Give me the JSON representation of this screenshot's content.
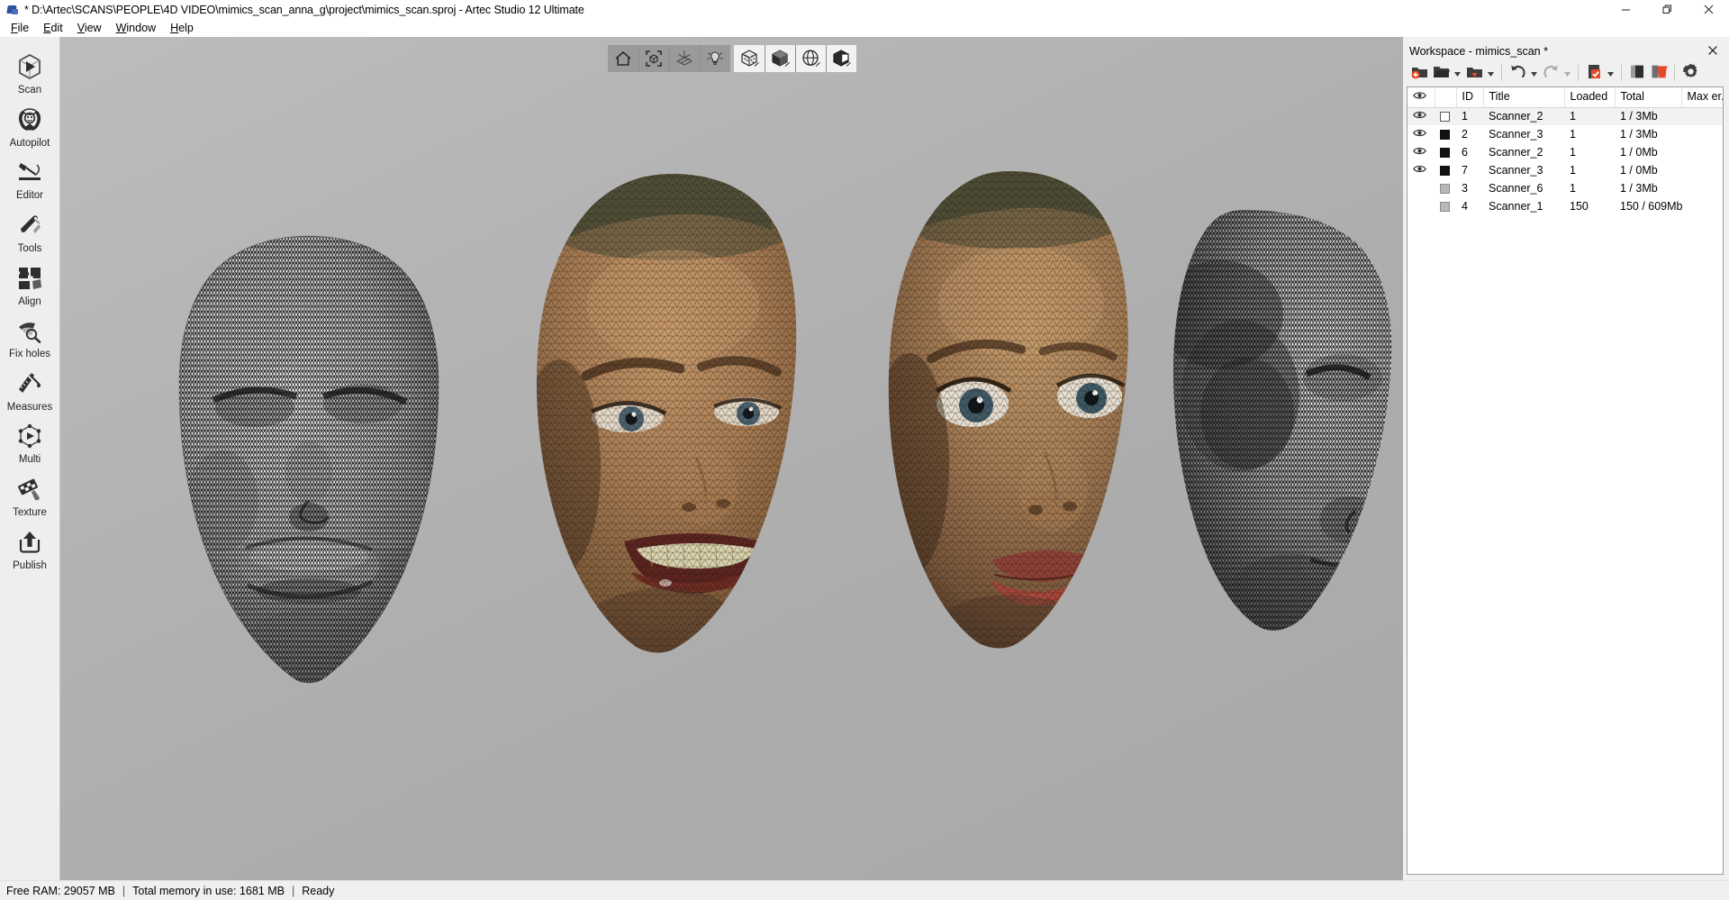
{
  "window": {
    "title": "* D:\\Artec\\SCANS\\PEOPLE\\4D VIDEO\\mimics_scan_anna_g\\project\\mimics_scan.sproj - Artec Studio 12 Ultimate",
    "app_icon": "artec-app-icon",
    "controls": {
      "minimize": "minimize-button",
      "restore": "restore-button",
      "close": "close-button"
    }
  },
  "menubar": {
    "items": [
      {
        "label": "File",
        "accel": "F"
      },
      {
        "label": "Edit",
        "accel": "E"
      },
      {
        "label": "View",
        "accel": "V"
      },
      {
        "label": "Window",
        "accel": "W"
      },
      {
        "label": "Help",
        "accel": "H"
      }
    ]
  },
  "sidebar": {
    "items": [
      {
        "label": "Scan",
        "icon": "scan-icon"
      },
      {
        "label": "Autopilot",
        "icon": "autopilot-icon"
      },
      {
        "label": "Editor",
        "icon": "editor-icon"
      },
      {
        "label": "Tools",
        "icon": "tools-icon"
      },
      {
        "label": "Align",
        "icon": "align-icon"
      },
      {
        "label": "Fix holes",
        "icon": "fix-holes-icon"
      },
      {
        "label": "Measures",
        "icon": "measures-icon"
      },
      {
        "label": "Multi",
        "icon": "multi-icon"
      },
      {
        "label": "Texture",
        "icon": "texture-icon"
      },
      {
        "label": "Publish",
        "icon": "publish-icon"
      }
    ]
  },
  "viewport": {
    "toolbar": {
      "group1": [
        {
          "name": "home-view-button",
          "icon": "home-icon"
        },
        {
          "name": "fit-to-view-button",
          "icon": "bounding-box-icon"
        },
        {
          "name": "toggle-grid-button",
          "icon": "grid-axes-icon"
        },
        {
          "name": "lighting-button",
          "icon": "lightbulb-icon"
        }
      ],
      "group2": [
        {
          "name": "render-points-button",
          "icon": "cube-points-icon"
        },
        {
          "name": "render-solid-button",
          "icon": "cube-solid-icon"
        },
        {
          "name": "render-wireframe-button",
          "icon": "sphere-wireframe-icon"
        },
        {
          "name": "render-textured-button",
          "icon": "cube-textured-icon"
        }
      ]
    },
    "objects": [
      {
        "name": "face-wireframe-smiling",
        "style": "wireframe"
      },
      {
        "name": "face-textured-smiling",
        "style": "textured"
      },
      {
        "name": "face-textured-surprised",
        "style": "textured"
      },
      {
        "name": "face-wireframe-profile",
        "style": "wireframe"
      }
    ]
  },
  "workspace": {
    "title": "Workspace - mimics_scan *",
    "close_label": "×",
    "toolbar": [
      {
        "name": "new-project-button",
        "icon": "folder-add-icon",
        "has_arrow": false,
        "disabled": false
      },
      {
        "name": "open-project-button",
        "icon": "folder-open-icon",
        "has_arrow": true,
        "disabled": false
      },
      {
        "name": "import-button",
        "icon": "folder-import-icon",
        "has_arrow": true,
        "disabled": false
      },
      {
        "name": "undo-button",
        "icon": "undo-icon",
        "has_arrow": true,
        "disabled": false
      },
      {
        "name": "redo-button",
        "icon": "redo-icon",
        "has_arrow": true,
        "disabled": true
      },
      {
        "name": "select-all-button",
        "icon": "checkbox-select-icon",
        "has_arrow": true,
        "disabled": false
      },
      {
        "name": "duplicate-button",
        "icon": "copy-icon",
        "has_arrow": false,
        "disabled": false
      },
      {
        "name": "delete-button",
        "icon": "delete-icon",
        "has_arrow": false,
        "disabled": false
      },
      {
        "name": "settings-button",
        "icon": "gear-icon",
        "has_arrow": false,
        "disabled": false
      }
    ],
    "table": {
      "columns": [
        {
          "key": "visible",
          "label": "",
          "icon": "eye-icon"
        },
        {
          "key": "selected",
          "label": ""
        },
        {
          "key": "id",
          "label": "ID"
        },
        {
          "key": "title",
          "label": "Title"
        },
        {
          "key": "loaded",
          "label": "Loaded"
        },
        {
          "key": "total",
          "label": "Total"
        },
        {
          "key": "maxerr",
          "label": "Max er..."
        }
      ],
      "rows": [
        {
          "visible": true,
          "check": "empty",
          "id": "1",
          "title": "Scanner_2",
          "loaded": "1",
          "total": "1 / 3Mb",
          "maxerr": "",
          "selected": true
        },
        {
          "visible": true,
          "check": "filled",
          "id": "2",
          "title": "Scanner_3",
          "loaded": "1",
          "total": "1 / 3Mb",
          "maxerr": "",
          "selected": false
        },
        {
          "visible": true,
          "check": "filled",
          "id": "6",
          "title": "Scanner_2",
          "loaded": "1",
          "total": "1 / 0Mb",
          "maxerr": "",
          "selected": false
        },
        {
          "visible": true,
          "check": "filled",
          "id": "7",
          "title": "Scanner_3",
          "loaded": "1",
          "total": "1 / 0Mb",
          "maxerr": "",
          "selected": false
        },
        {
          "visible": false,
          "check": "gray",
          "id": "3",
          "title": "Scanner_6",
          "loaded": "1",
          "total": "1 / 3Mb",
          "maxerr": "",
          "selected": false
        },
        {
          "visible": false,
          "check": "gray",
          "id": "4",
          "title": "Scanner_1",
          "loaded": "150",
          "total": "150 / 609Mb",
          "maxerr": "",
          "selected": false
        }
      ]
    }
  },
  "statusbar": {
    "free_ram": "Free RAM: 29057 MB",
    "sep1": "|",
    "memory_in_use": "Total memory in use: 1681 MB",
    "sep2": "|",
    "state": "Ready"
  },
  "colors": {
    "accent_red": "#e8482a",
    "window_bg": "#f0f0f0",
    "sidebar_bg": "#eeeeee",
    "viewport_top": "#bcbcbc",
    "viewport_bottom": "#a9a9a9",
    "selection_row": "#f2f2f2"
  }
}
